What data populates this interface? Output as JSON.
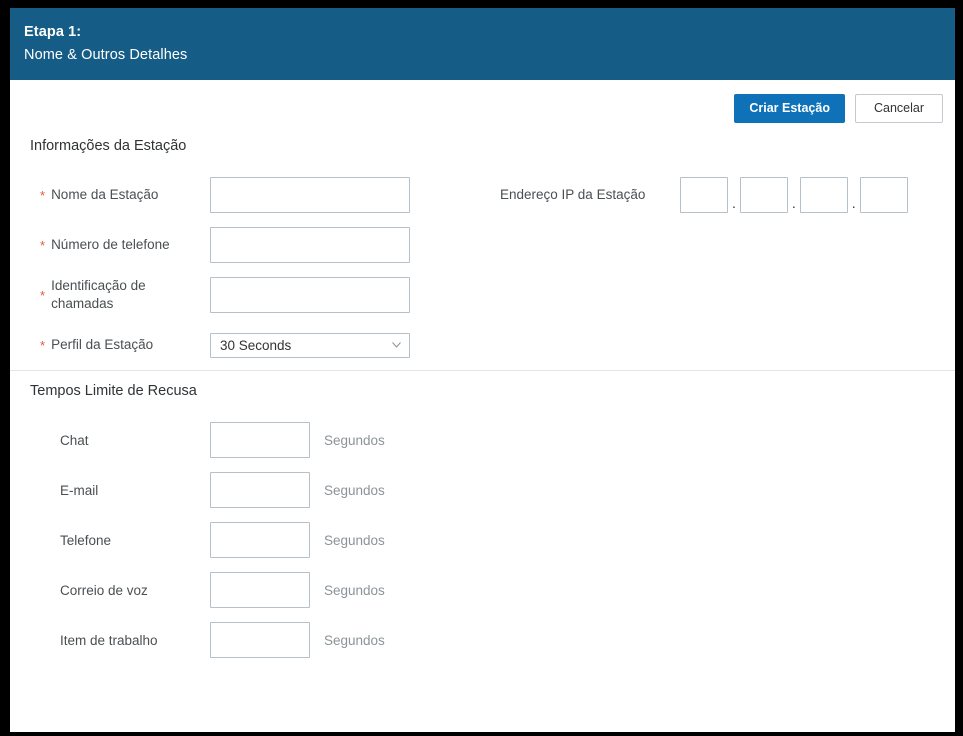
{
  "window": {
    "frame_color": "#000000",
    "page_background": "#ffffff"
  },
  "header": {
    "accent_color": "#155d87",
    "step_label": "Etapa 1:",
    "step_title": "Nome & Outros Detalhes"
  },
  "toolbar": {
    "primary_label": "Criar Estação",
    "primary_color": "#0f72b8",
    "secondary_label": "Cancelar"
  },
  "station_info": {
    "title": "Informações da Estação",
    "required_marker": "*",
    "required_color": "#e8553f",
    "fields": [
      {
        "label": "Nome da Estação",
        "required": true,
        "type": "text",
        "value": "",
        "placeholder": ""
      },
      {
        "label": "Número de telefone",
        "required": true,
        "type": "text",
        "value": "",
        "placeholder": ""
      },
      {
        "label": "Identificação de chamadas",
        "required": true,
        "type": "text",
        "value": "",
        "placeholder": ""
      },
      {
        "label": "Perfil da Estação",
        "required": true,
        "type": "select",
        "value": "30 Seconds",
        "options": [
          "30 Seconds"
        ]
      }
    ],
    "ip_address": {
      "label": "Endereço IP da Estação",
      "separator": ".",
      "octets": [
        "",
        "",
        "",
        ""
      ]
    }
  },
  "refusal_timeouts": {
    "title": "Tempos Limite de Recusa",
    "unit_label": "Segundos",
    "rows": [
      {
        "label": "Chat",
        "value": ""
      },
      {
        "label": "E-mail",
        "value": ""
      },
      {
        "label": "Telefone",
        "value": ""
      },
      {
        "label": "Correio de voz",
        "value": ""
      },
      {
        "label": "Item de trabalho",
        "value": ""
      }
    ]
  }
}
